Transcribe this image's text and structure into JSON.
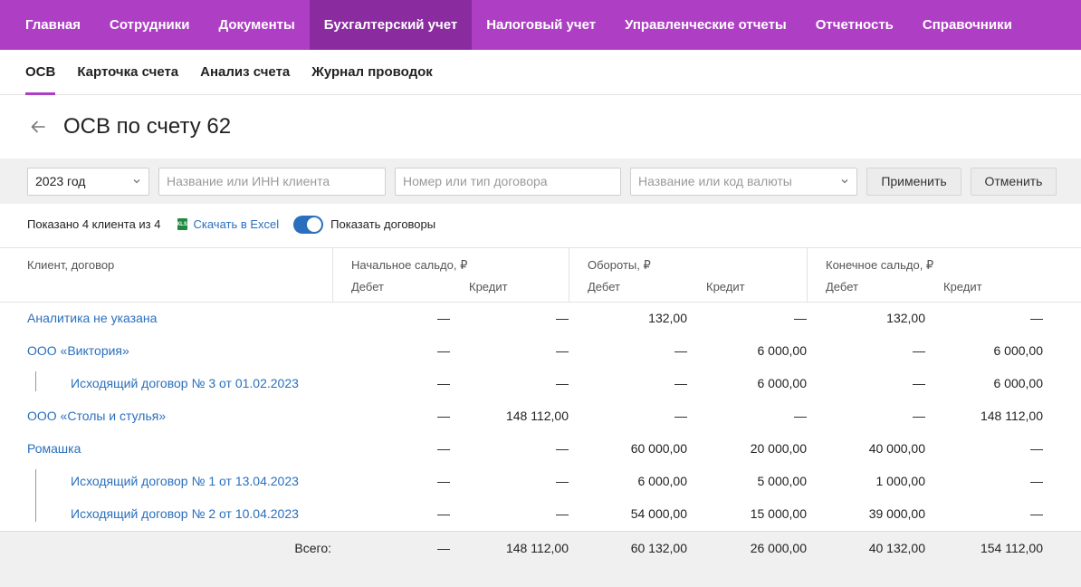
{
  "topnav": {
    "items": [
      "Главная",
      "Сотрудники",
      "Документы",
      "Бухгалтерский учет",
      "Налоговый учет",
      "Управленческие отчеты",
      "Отчетность",
      "Справочники"
    ]
  },
  "subnav": {
    "items": [
      "ОСВ",
      "Карточка счета",
      "Анализ счета",
      "Журнал проводок"
    ]
  },
  "page": {
    "title": "ОСВ по счету 62"
  },
  "filters": {
    "year_value": "2023 год",
    "client_placeholder": "Название или ИНН клиента",
    "contract_placeholder": "Номер или тип договора",
    "currency_placeholder": "Название или код валюты",
    "apply_label": "Применить",
    "cancel_label": "Отменить"
  },
  "info": {
    "shown_text": "Показано 4 клиента из 4",
    "excel_label": "Скачать в Excel",
    "excel_icon_text": "XLS",
    "toggle_label": "Показать договоры"
  },
  "table": {
    "col_client": "Клиент, договор",
    "group_opening": "Начальное сальдо, ₽",
    "group_turnover": "Обороты, ₽",
    "group_closing": "Конечное сальдо, ₽",
    "debit": "Дебет",
    "credit": "Кредит",
    "rows": [
      {
        "name": "Аналитика не указана",
        "level": 0,
        "values": [
          "—",
          "—",
          "132,00",
          "—",
          "132,00",
          "—"
        ]
      },
      {
        "name": "ООО «Виктория»",
        "level": 0,
        "values": [
          "—",
          "—",
          "—",
          "6 000,00",
          "—",
          "6 000,00"
        ]
      },
      {
        "name": "Исходящий договор № 3 от 01.02.2023",
        "level": 1,
        "values": [
          "—",
          "—",
          "—",
          "6 000,00",
          "—",
          "6 000,00"
        ]
      },
      {
        "name": "ООО «Столы и стулья»",
        "level": 0,
        "values": [
          "—",
          "148 112,00",
          "—",
          "—",
          "—",
          "148 112,00"
        ]
      },
      {
        "name": "Ромашка",
        "level": 0,
        "values": [
          "—",
          "—",
          "60 000,00",
          "20 000,00",
          "40 000,00",
          "—"
        ]
      },
      {
        "name": "Исходящий договор № 1 от 13.04.2023",
        "level": 1,
        "values": [
          "—",
          "—",
          "6 000,00",
          "5 000,00",
          "1 000,00",
          "—"
        ]
      },
      {
        "name": "Исходящий договор № 2 от 10.04.2023",
        "level": 1,
        "values": [
          "—",
          "—",
          "54 000,00",
          "15 000,00",
          "39 000,00",
          "—"
        ]
      }
    ],
    "total_label": "Всего:",
    "total_values": [
      "—",
      "148 112,00",
      "60 132,00",
      "26 000,00",
      "40 132,00",
      "154 112,00"
    ]
  },
  "colors": {
    "brand": "#ae3fc4",
    "brand_active": "#8a2c9f",
    "link": "#2a6fbd"
  }
}
